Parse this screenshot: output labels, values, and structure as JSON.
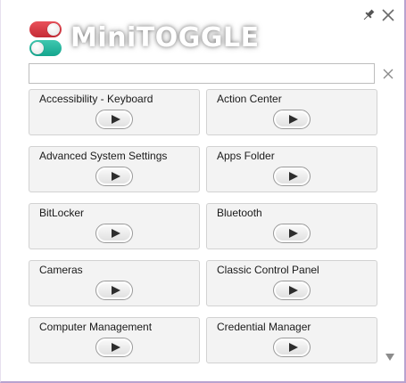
{
  "app": {
    "title": "MiniTOGGLE"
  },
  "search": {
    "value": "",
    "placeholder": ""
  },
  "icons": {
    "pin": "pin-icon",
    "close": "close-icon",
    "clear": "clear-icon",
    "play": "play-icon",
    "scroll_down": "chevron-down-icon"
  },
  "colors": {
    "toggle_red": "#d8333d",
    "toggle_green": "#1fb39a",
    "window_border": "#b9a2cf"
  },
  "tiles": [
    {
      "label": "Accessibility - Keyboard"
    },
    {
      "label": "Action Center"
    },
    {
      "label": "Advanced System Settings"
    },
    {
      "label": "Apps Folder"
    },
    {
      "label": "BitLocker"
    },
    {
      "label": "Bluetooth"
    },
    {
      "label": "Cameras"
    },
    {
      "label": "Classic Control Panel"
    },
    {
      "label": "Computer Management"
    },
    {
      "label": "Credential Manager"
    }
  ]
}
